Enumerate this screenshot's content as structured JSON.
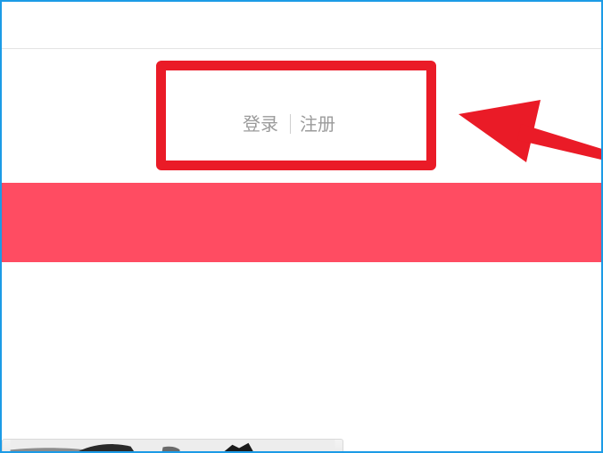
{
  "auth": {
    "login_label": "登录",
    "register_label": "注册"
  },
  "colors": {
    "frame_border": "#1c9be6",
    "highlight_red": "#ea1b27",
    "banner_pink": "#ff4c62",
    "link_gray": "#9b9b9b"
  },
  "icons": {
    "annotation_arrow": "arrow-pointing-left-icon"
  }
}
